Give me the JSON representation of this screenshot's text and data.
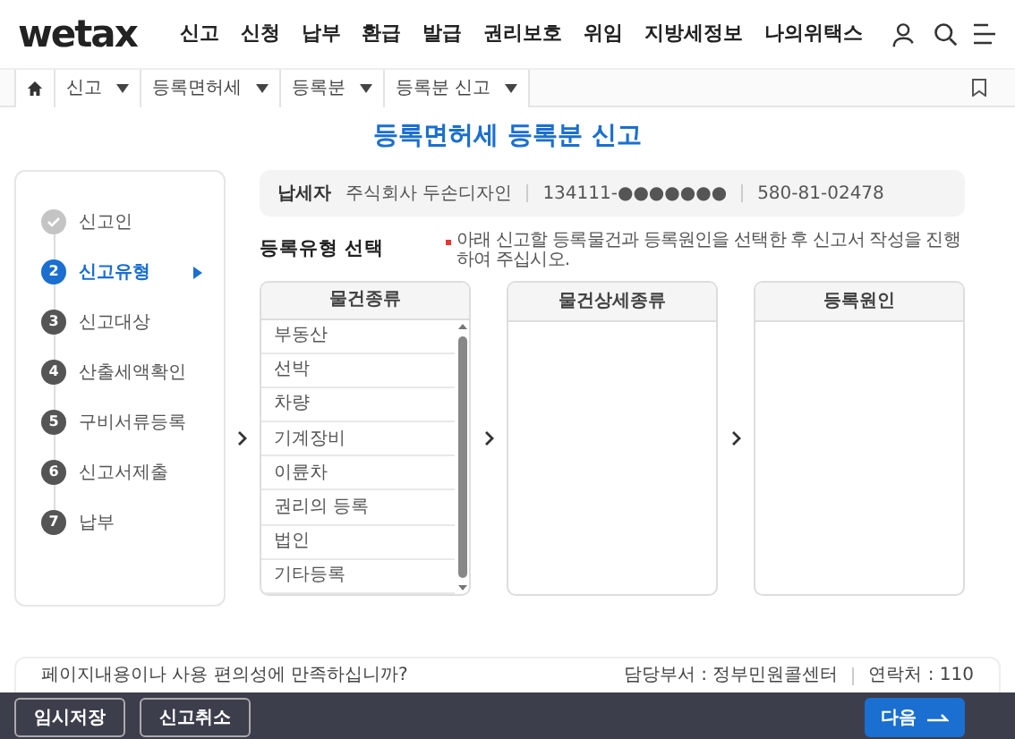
{
  "header": {
    "logo": "wetax",
    "nav": [
      "신고",
      "신청",
      "납부",
      "환급",
      "발급",
      "권리보호",
      "위임",
      "지방세정보",
      "나의위택스"
    ]
  },
  "breadcrumb": [
    "신고",
    "등록면허세",
    "등록분",
    "등록분 신고"
  ],
  "title": "등록면허세 등록분 신고",
  "steps": [
    {
      "label": "신고인",
      "completed": true,
      "selected": false
    },
    {
      "number": "2",
      "label": "신고유형",
      "completed": false,
      "selected": true
    },
    {
      "number": "3",
      "label": "신고대상",
      "completed": false,
      "selected": false
    },
    {
      "number": "4",
      "label": "산출세액확인",
      "completed": false,
      "selected": false
    },
    {
      "number": "5",
      "label": "구비서류등록",
      "completed": false,
      "selected": false
    },
    {
      "number": "6",
      "label": "신고서제출",
      "completed": false,
      "selected": false
    },
    {
      "number": "7",
      "label": "납부",
      "completed": false,
      "selected": false
    }
  ],
  "taxpayer": {
    "label": "납세자",
    "name": "주식회사 두손디자인",
    "id_number": "134111-●●●●●●●",
    "business_number": "580-81-02478"
  },
  "section": {
    "heading": "등록유형 선택",
    "note": "아래 신고할 등록물건과 등록원인을 선택한 후 신고서 작성을 진행하여 주십시오."
  },
  "columns": [
    {
      "header": "물건종류",
      "items": [
        "부동산",
        "선박",
        "차량",
        "기계장비",
        "이륜차",
        "권리의 등록",
        "법인",
        "기타등록"
      ]
    },
    {
      "header": "물건상세종류"
    },
    {
      "header": "등록원인"
    }
  ],
  "survey": {
    "question": "페이지내용이나 사용 편의성에 만족하십니까?",
    "department": "담당부서 : 정부민원콜센터",
    "contact": "연락처 : 110"
  },
  "buttons": {
    "save": "임시저장",
    "cancel": "신고취소",
    "next": "다음"
  }
}
